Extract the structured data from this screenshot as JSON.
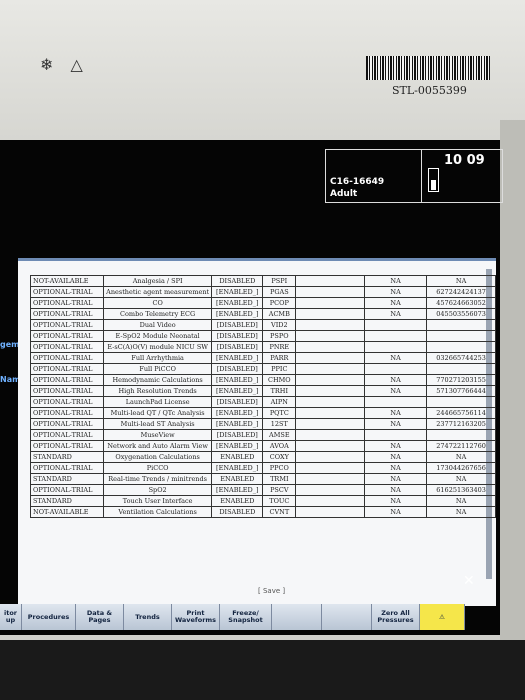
{
  "device": {
    "asset_tag": "STL-0055399"
  },
  "header": {
    "patient_id": "C16-16649",
    "patient_category": "Adult",
    "time": "10 09"
  },
  "side_labels": [
    "gement",
    "Name"
  ],
  "table": {
    "rows": [
      {
        "status": "NOT-AVAILABLE",
        "feature": "Analgesia / SPI",
        "state": "DISABLED",
        "code": "PSPI",
        "na": "NA",
        "key": "NA"
      },
      {
        "status": "OPTIONAL-TRIAL",
        "feature": "Anesthetic agent measurement",
        "state": "[ENABLED_]",
        "code": "PGAS",
        "na": "NA",
        "key": "627242424137"
      },
      {
        "status": "OPTIONAL-TRIAL",
        "feature": "CO",
        "state": "[ENABLED_]",
        "code": "PCOP",
        "na": "NA",
        "key": "457624663052"
      },
      {
        "status": "OPTIONAL-TRIAL",
        "feature": "Combo Telemetry ECG",
        "state": "[ENABLED_]",
        "code": "ACMB",
        "na": "NA",
        "key": "045503556073"
      },
      {
        "status": "OPTIONAL-TRIAL",
        "feature": "Dual Video",
        "state": "[DISABLED]",
        "code": "VID2",
        "na": "",
        "key": ""
      },
      {
        "status": "OPTIONAL-TRIAL",
        "feature": "E-SpO2 Module Neonatal",
        "state": "[DISABLED]",
        "code": "PSPO",
        "na": "",
        "key": ""
      },
      {
        "status": "OPTIONAL-TRIAL",
        "feature": "E-sC(A)O(V) module NICU SW",
        "state": "[DISABLED]",
        "code": "PNRE",
        "na": "",
        "key": ""
      },
      {
        "status": "OPTIONAL-TRIAL",
        "feature": "Full Arrhythmia",
        "state": "[ENABLED_]",
        "code": "PARR",
        "na": "NA",
        "key": "032665744253"
      },
      {
        "status": "OPTIONAL-TRIAL",
        "feature": "Full PiCCO",
        "state": "[DISABLED]",
        "code": "PPIC",
        "na": "",
        "key": ""
      },
      {
        "status": "OPTIONAL-TRIAL",
        "feature": "Hemodynamic Calculations",
        "state": "[ENABLED_]",
        "code": "CHMO",
        "na": "NA",
        "key": "770271203155"
      },
      {
        "status": "OPTIONAL-TRIAL",
        "feature": "High Resolution Trends",
        "state": "[ENABLED_]",
        "code": "TRHI",
        "na": "NA",
        "key": "571307766444"
      },
      {
        "status": "OPTIONAL-TRIAL",
        "feature": "LaunchPad License",
        "state": "[DISABLED]",
        "code": "AIPN",
        "na": "",
        "key": ""
      },
      {
        "status": "OPTIONAL-TRIAL",
        "feature": "Multi-lead QT / QTc Analysis",
        "state": "[ENABLED_]",
        "code": "PQTC",
        "na": "NA",
        "key": "244665756114"
      },
      {
        "status": "OPTIONAL-TRIAL",
        "feature": "Multi-lead ST Analysis",
        "state": "[ENABLED_]",
        "code": "12ST",
        "na": "NA",
        "key": "237712163205"
      },
      {
        "status": "OPTIONAL-TRIAL",
        "feature": "MuseView",
        "state": "[DISABLED]",
        "code": "AMSE",
        "na": "",
        "key": ""
      },
      {
        "status": "OPTIONAL-TRIAL",
        "feature": "Network and Auto Alarm View",
        "state": "[ENABLED_]",
        "code": "AVOA",
        "na": "NA",
        "key": "274722112760"
      },
      {
        "status": "STANDARD",
        "feature": "Oxygenation Calculations",
        "state": "ENABLED",
        "code": "COXY",
        "na": "NA",
        "key": "NA"
      },
      {
        "status": "OPTIONAL-TRIAL",
        "feature": "PiCCO",
        "state": "[ENABLED_]",
        "code": "PPCO",
        "na": "NA",
        "key": "173044267656"
      },
      {
        "status": "STANDARD",
        "feature": "Real-time Trends / minitrends",
        "state": "ENABLED",
        "code": "TRMI",
        "na": "NA",
        "key": "NA"
      },
      {
        "status": "OPTIONAL-TRIAL",
        "feature": "SpO2",
        "state": "[ENABLED_]",
        "code": "PSCV",
        "na": "NA",
        "key": "616251363403"
      },
      {
        "status": "STANDARD",
        "feature": "Touch User Interface",
        "state": "ENABLED",
        "code": "TOUC",
        "na": "NA",
        "key": "NA"
      },
      {
        "status": "NOT-AVAILABLE",
        "feature": "Ventilation Calculations",
        "state": "DISABLED",
        "code": "CVNT",
        "na": "NA",
        "key": "NA"
      }
    ],
    "save_label": "[ Save ]"
  },
  "softkeys": [
    {
      "label": "itor up"
    },
    {
      "label": "Procedures"
    },
    {
      "label": "Data & Pages"
    },
    {
      "label": "Trends"
    },
    {
      "label": "Print Waveforms"
    },
    {
      "label": "Freeze/ Snapshot"
    },
    {
      "label": ""
    },
    {
      "label": ""
    },
    {
      "label": "Zero All Pressures"
    },
    {
      "label": ""
    }
  ],
  "icons": [
    "alarm-audio-icon",
    "alarm-triangle-icon",
    "battery-icon",
    "alarm-silence-icon"
  ],
  "colors": {
    "window_accent": "#6e8bb4",
    "softkey": "#c9d3e0",
    "alarm_key": "#f5e64a",
    "side_label": "#6fb1ff"
  }
}
